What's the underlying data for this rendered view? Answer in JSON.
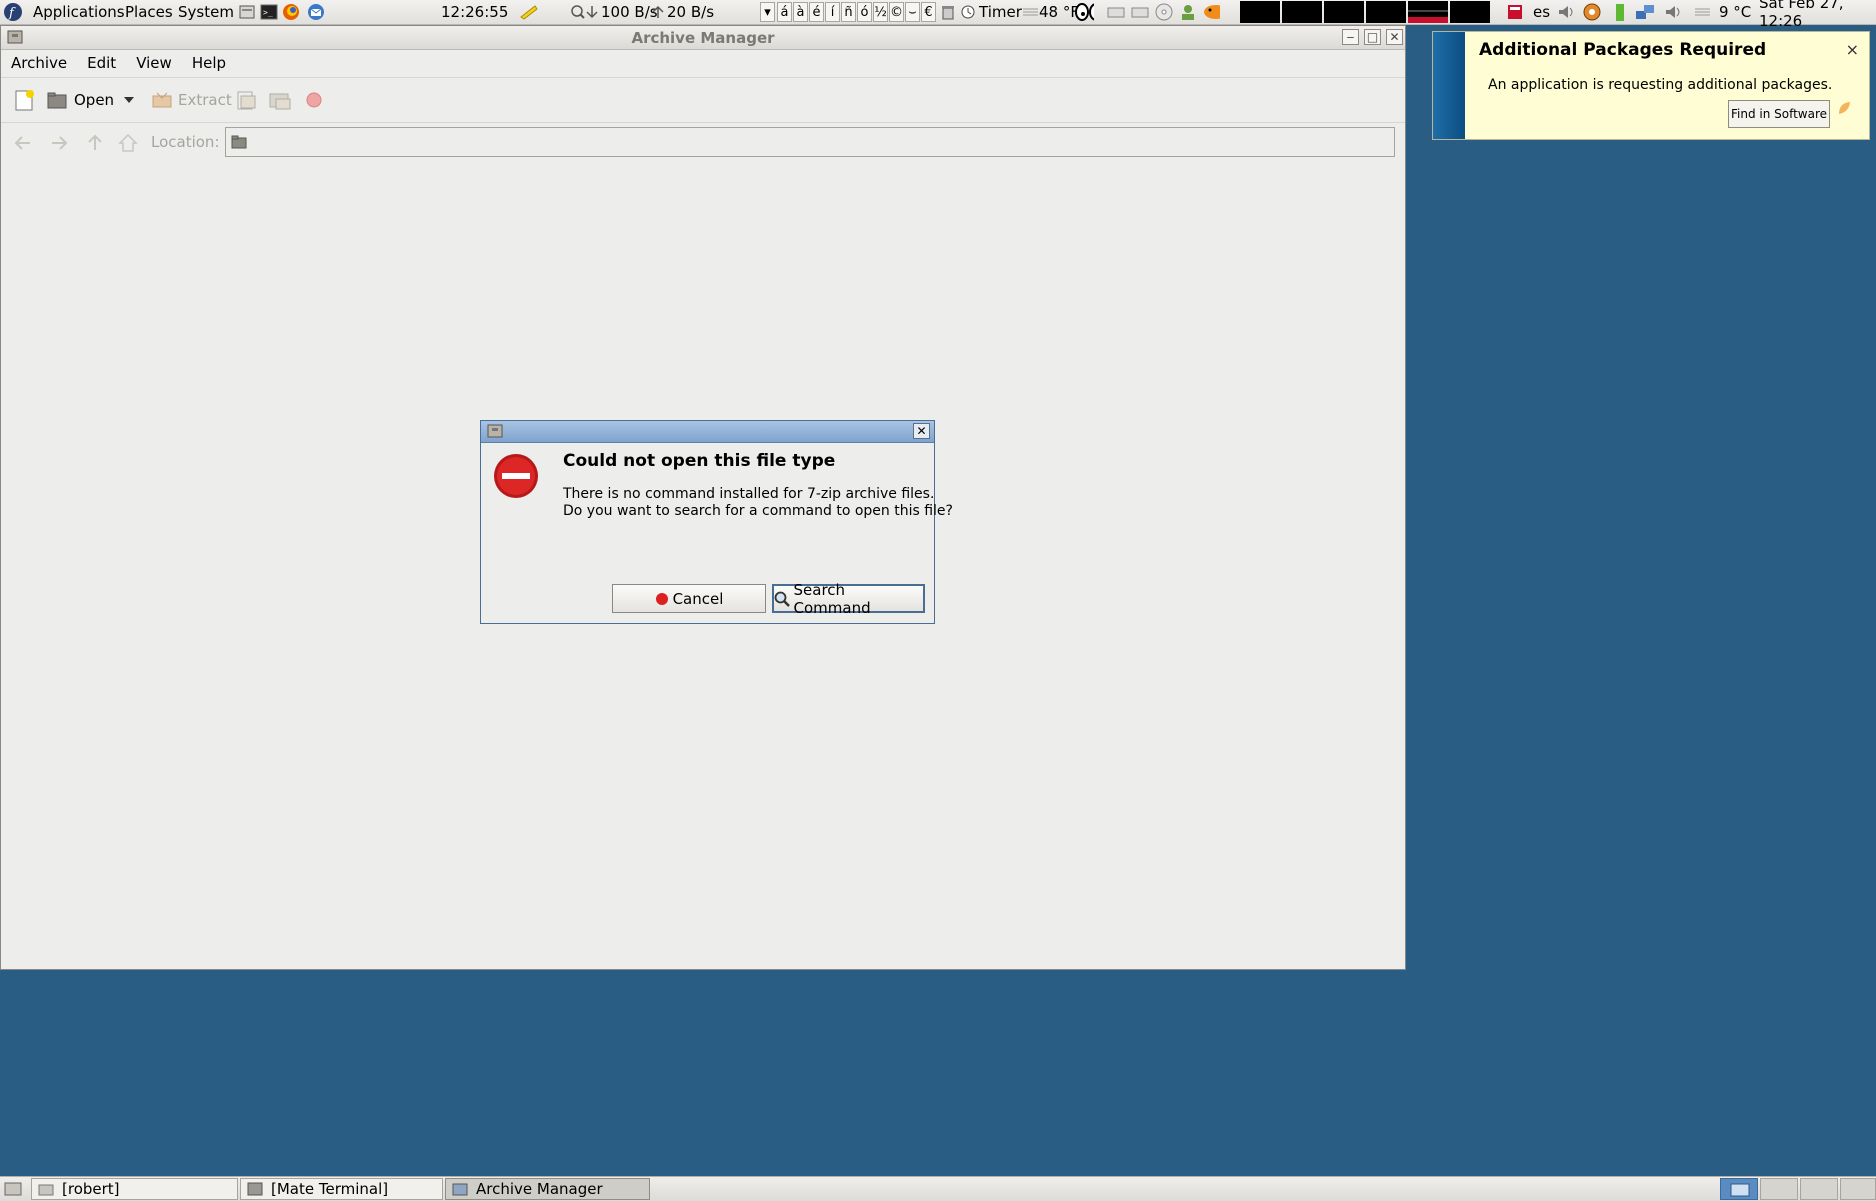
{
  "top_panel": {
    "menus": [
      "Applications",
      "Places",
      "System"
    ],
    "clock": "12:26:55",
    "net_down": "100 B/s",
    "net_up": "20 B/s",
    "chars": [
      "á",
      "à",
      "é",
      "í",
      "ñ",
      "ó",
      "½",
      "©",
      "⌣",
      "€"
    ],
    "timer_label": "Timer",
    "temp_f": "48 °F",
    "keyboard_layout": "es",
    "temp_c": "9 °C",
    "datetime": "Sat Feb 27, 12:26"
  },
  "window": {
    "title": "Archive Manager",
    "menus": [
      "Archive",
      "Edit",
      "View",
      "Help"
    ],
    "toolbar": {
      "open_label": "Open",
      "extract_label": "Extract"
    },
    "location_label": "Location:"
  },
  "dialog": {
    "heading": "Could not open this file type",
    "message_line1": "There is no command installed for 7-zip archive files.",
    "message_line2": "Do you want to search for a command to open this file?",
    "cancel_label": "Cancel",
    "search_label": "Search Command"
  },
  "notification": {
    "title": "Additional Packages Required",
    "body": "An application is requesting additional packages.",
    "button_label": "Find in Software",
    "close_glyph": "×"
  },
  "taskbar": {
    "items": [
      {
        "label": "[robert]"
      },
      {
        "label": "[Mate Terminal]"
      },
      {
        "label": "Archive Manager"
      }
    ]
  },
  "colors": {
    "desktop": "#295d84",
    "window_bg": "#ededeb",
    "dialog_title": "#7fa3cf",
    "error_icon": "#cc1f1f",
    "notification_bg": "#fefdd3"
  }
}
